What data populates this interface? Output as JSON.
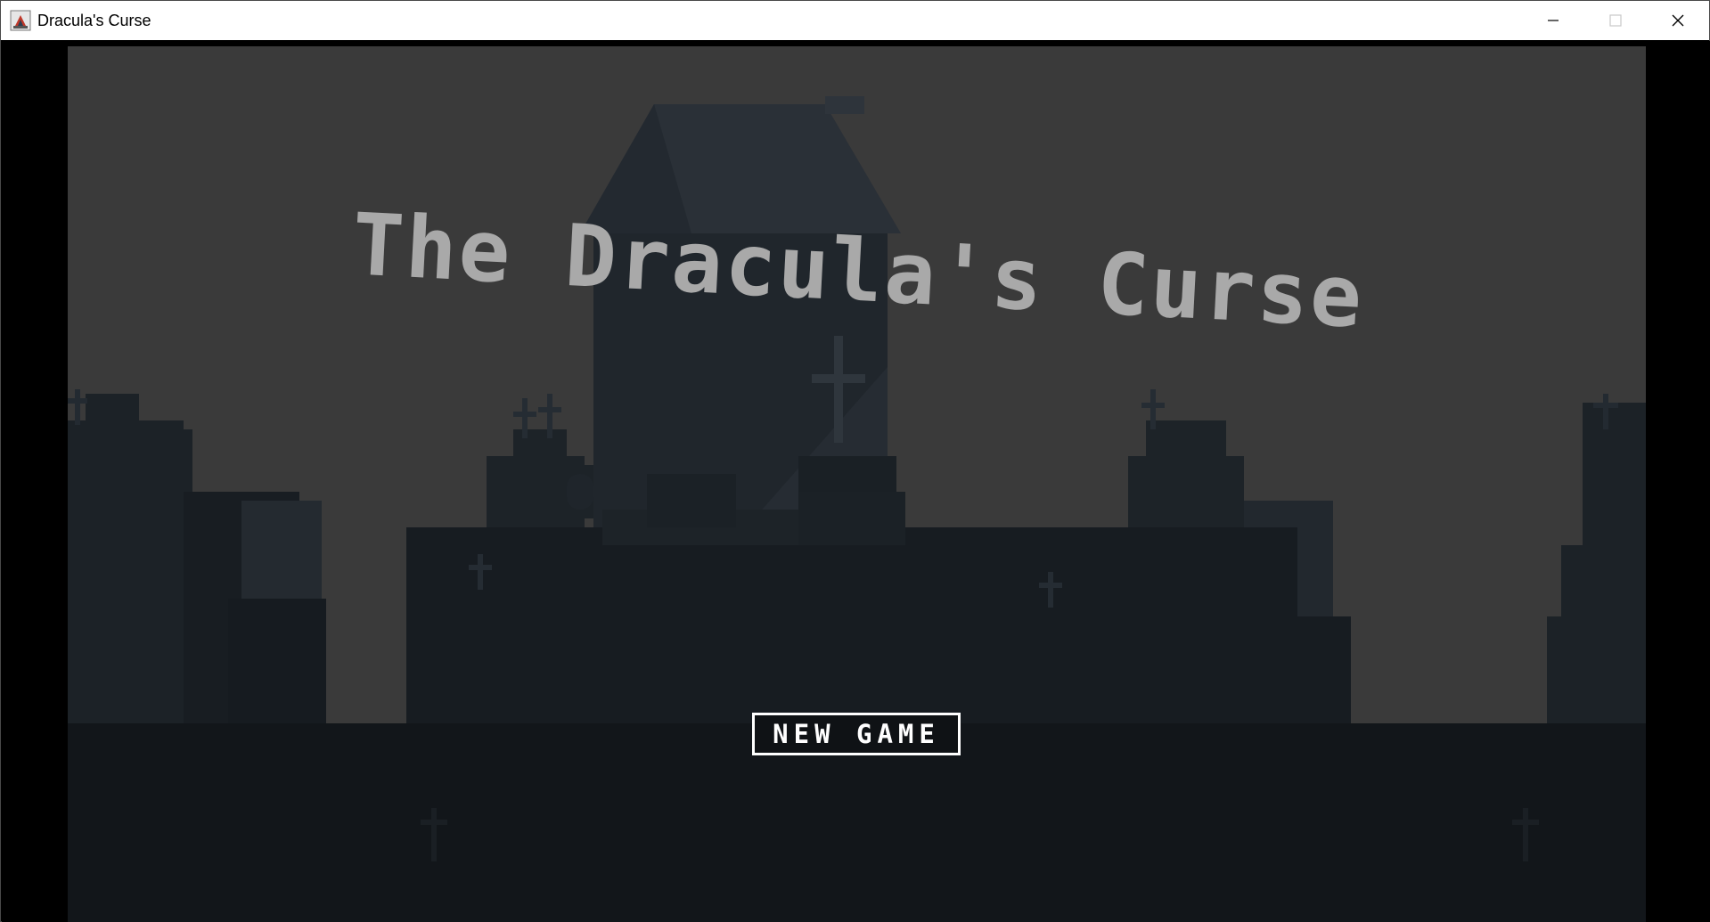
{
  "window": {
    "title": "Dracula's Curse",
    "app_icon": "java-app-icon",
    "controls": [
      "minimize-icon",
      "maximize-icon",
      "close-icon"
    ]
  },
  "game": {
    "title_text": "The Dracula's Curse",
    "title_color": "#a9a9a9",
    "menu": {
      "new_game_label": "NEW GAME"
    },
    "colors": {
      "sky": "#3a3a3a",
      "silhouette_dark": "#12161a",
      "silhouette_mid": "#1c2227",
      "building": "#20262c",
      "roof": "#2a3037",
      "button_border": "#ffffff"
    }
  }
}
